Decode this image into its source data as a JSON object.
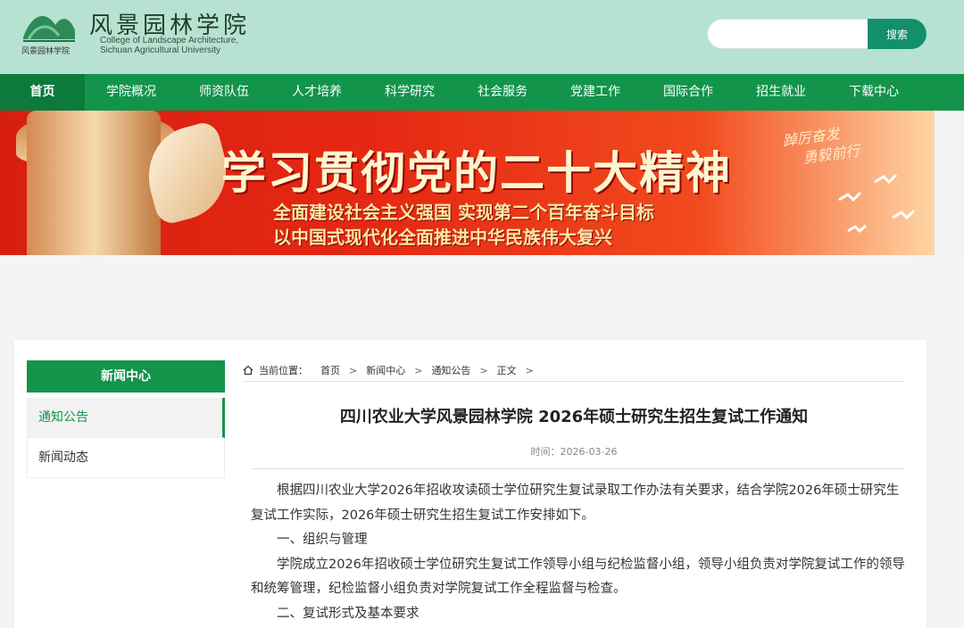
{
  "header": {
    "logo_caption": "风景园林学院",
    "brand_cn": "风景园林学院",
    "brand_en_line1": "College of Landscape Architecture,",
    "brand_en_line2": "Sichuan Agricultural University",
    "search": {
      "placeholder": "",
      "button": "搜索"
    }
  },
  "nav": {
    "items": [
      "首页",
      "学院概况",
      "师资队伍",
      "人才培养",
      "科学研究",
      "社会服务",
      "党建工作",
      "国际合作",
      "招生就业",
      "下载中心"
    ]
  },
  "banner": {
    "title": "学习贯彻党的二十大精神",
    "sub1": "全面建设社会主义强国 实现第二个百年奋斗目标",
    "sub2": "以中国式现代化全面推进中华民族伟大复兴",
    "side1": "踔厉奋发",
    "side2": "勇毅前行"
  },
  "sidebar": {
    "title": "新闻中心",
    "items": [
      "通知公告",
      "新闻动态"
    ]
  },
  "breadcrumb": {
    "label": "当前位置：",
    "items": [
      "首页",
      "新闻中心",
      "通知公告",
      "正文"
    ]
  },
  "article": {
    "title": "四川农业大学风景园林学院 2026年硕士研究生招生复试工作通知",
    "time": "时间：2026-03-26",
    "paragraphs": [
      "根据四川农业大学2026年招收攻读硕士学位研究生复试录取工作办法有关要求，结合学院2026年硕士研究生复试工作实际，2026年硕士研究生招生复试工作安排如下。",
      "一、组织与管理",
      "学院成立2026年招收硕士学位研究生复试工作领导小组与纪检监督小组，领导小组负责对学院复试工作的领导和统筹管理，纪检监督小组负责对学院复试工作全程监督与检查。",
      "二、复试形式及基本要求"
    ]
  },
  "colors": {
    "nav": "#12944b",
    "header_bg": "#b7e2d2",
    "accent": "#11906b"
  }
}
